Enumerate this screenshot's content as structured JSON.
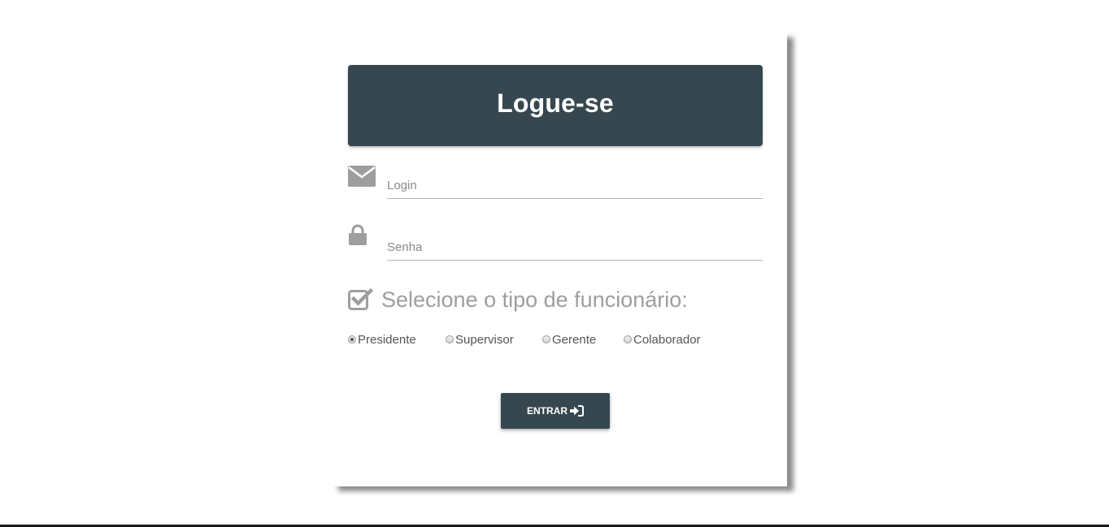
{
  "header": {
    "title": "Logue-se"
  },
  "form": {
    "login": {
      "placeholder": "Login",
      "value": ""
    },
    "senha": {
      "placeholder": "Senha",
      "value": ""
    },
    "type_title": "Selecione o tipo de funcionário:",
    "options": [
      {
        "label": "Presidente",
        "checked": true
      },
      {
        "label": "Supervisor",
        "checked": false
      },
      {
        "label": "Gerente",
        "checked": false
      },
      {
        "label": "Colaborador",
        "checked": false
      }
    ],
    "submit_label": "ENTRAR"
  },
  "icons": {
    "login": "envelope-icon",
    "senha": "lock-icon",
    "type_title": "check-square-icon",
    "submit": "sign-in-icon"
  },
  "colors": {
    "primary": "#37474f",
    "icon_gray": "#9e9e9e",
    "text": "#555555",
    "underline": "#b5b5b5"
  }
}
